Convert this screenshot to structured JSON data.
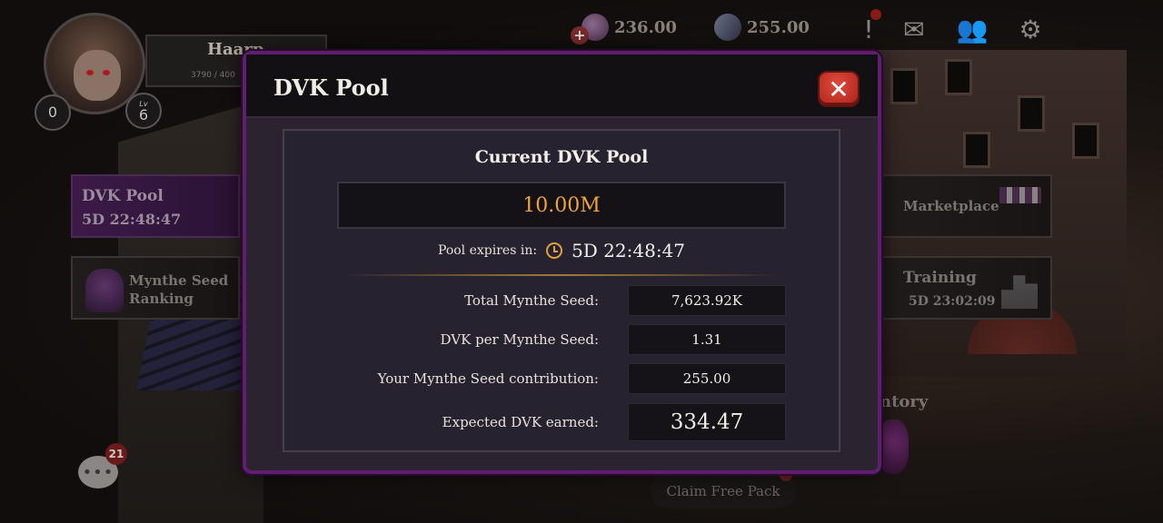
{
  "player": {
    "name": "Haarp",
    "xp": "3790 / 400",
    "badge_count": "0",
    "level_label": "Lv",
    "level": "6"
  },
  "resources": {
    "mynthe": "236.00",
    "gems": "255.00"
  },
  "sidebar_left": {
    "dvk_pool_label": "DVK Pool",
    "dvk_pool_timer": "5D 22:48:47",
    "ranking_line1": "Mynthe Seed",
    "ranking_line2": "Ranking"
  },
  "sidebar_right": {
    "marketplace_label": "Marketplace",
    "training_label": "Training",
    "training_timer": "5D 23:02:09",
    "inventory_label": "ntory"
  },
  "chat": {
    "badge": "21",
    "glyph": "•••"
  },
  "claim_button": "Claim Free Pack",
  "modal": {
    "title": "DVK Pool",
    "close_glyph": "✕",
    "pool_title": "Current DVK Pool",
    "pool_amount": "10.00M",
    "expires_label": "Pool expires in:",
    "expires_value": "5D 22:48:47",
    "rows": [
      {
        "label": "Total Mynthe Seed:",
        "value": "7,623.92K"
      },
      {
        "label": "DVK per Mynthe Seed:",
        "value": "1.31"
      },
      {
        "label": "Your Mynthe Seed contribution:",
        "value": "255.00"
      },
      {
        "label": "Expected DVK earned:",
        "value": "334.47"
      }
    ]
  },
  "colors": {
    "modal_border": "#5f1e6e",
    "pool_amount": "#f0a43a",
    "close_button": "#d8382a",
    "accent_gold": "#e0a23a"
  },
  "icons": {
    "close": "close-icon",
    "clock": "clock-icon",
    "alert": "alert-icon",
    "mail": "mail-icon",
    "friends": "friends-icon",
    "settings": "gear-icon",
    "chat": "chat-icon"
  }
}
